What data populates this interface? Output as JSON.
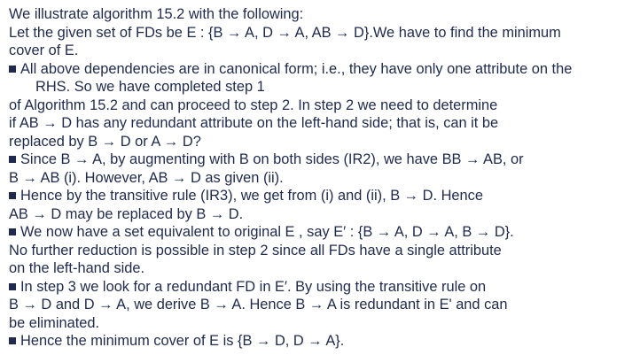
{
  "document": {
    "lines": [
      {
        "text": "We illustrate algorithm 15.2 with the following:",
        "bullet": false,
        "indent": false
      },
      {
        "text": "Let the given set of FDs be E : {B → A, D → A, AB → D}.We have to find the minimum",
        "bullet": false,
        "indent": false
      },
      {
        "text": "cover of E.",
        "bullet": false,
        "indent": false
      },
      {
        "text": "All above dependencies are in canonical form; i.e., they have only one attribute on the",
        "bullet": true,
        "indent": false
      },
      {
        "text": "RHS. So we have completed step 1",
        "bullet": false,
        "indent": true
      },
      {
        "text": "of Algorithm 15.2 and can proceed to step 2. In step 2 we need to determine",
        "bullet": false,
        "indent": false
      },
      {
        "text": "if AB → D has any redundant attribute on the left-hand side; that is, can it be",
        "bullet": false,
        "indent": false
      },
      {
        "text": "replaced by B → D or A → D?",
        "bullet": false,
        "indent": false
      },
      {
        "text": "Since B → A, by augmenting with B on both sides (IR2), we have BB → AB, or",
        "bullet": true,
        "indent": false
      },
      {
        "text": "B → AB (i). However, AB → D as given (ii).",
        "bullet": false,
        "indent": false
      },
      {
        "text": "Hence by the transitive rule (IR3), we get from (i) and (ii), B → D. Hence",
        "bullet": true,
        "indent": false
      },
      {
        "text": "AB → D may be replaced by B → D.",
        "bullet": false,
        "indent": false
      },
      {
        "text": "We now have a set equivalent to original E , say E′ : {B → A, D → A, B → D}.",
        "bullet": true,
        "indent": false
      },
      {
        "text": "No further reduction is possible in step 2 since all FDs have a single attribute",
        "bullet": false,
        "indent": false
      },
      {
        "text": "on the left-hand side.",
        "bullet": false,
        "indent": false
      },
      {
        "text": "In step 3 we look for a redundant FD in E′. By using the transitive rule on",
        "bullet": true,
        "indent": false
      },
      {
        "text": "B → D and D → A, we derive B → A. Hence B → A is redundant in E' and can",
        "bullet": false,
        "indent": false
      },
      {
        "text": "be eliminated.",
        "bullet": false,
        "indent": false
      },
      {
        "text": "Hence the minimum cover of E is {B → D, D → A}.",
        "bullet": true,
        "indent": false
      }
    ]
  }
}
